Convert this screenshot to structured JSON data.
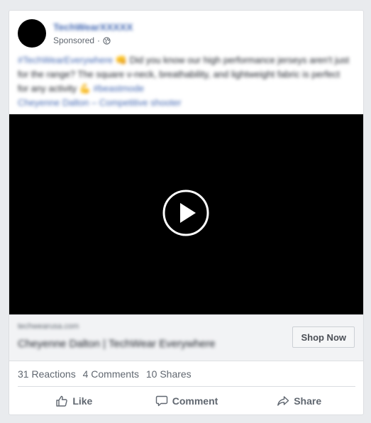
{
  "post": {
    "page_name": "TechWearXXXXX",
    "sponsored_label": "Sponsored",
    "meta_separator": "·",
    "text_hashtag": "#TechWearEverywhere",
    "text_emoji": "👊",
    "text_body": "Did you know our high performance jerseys aren't just for the range? The square v-neck, breathability, and lightweight fabric is perfect for any activity",
    "text_emoji2": "💪",
    "text_hashtag2": "#beastmode",
    "text_credit": "Cheyenne Dalton – Competitive shooter"
  },
  "link": {
    "domain": "techwearusa.com",
    "title": "Cheyenne Dalton | TechWear Everywhere",
    "cta_label": "Shop Now"
  },
  "stats": {
    "reactions": "31 Reactions",
    "comments": "4 Comments",
    "shares": "10 Shares"
  },
  "actions": {
    "like": "Like",
    "comment": "Comment",
    "share": "Share"
  }
}
